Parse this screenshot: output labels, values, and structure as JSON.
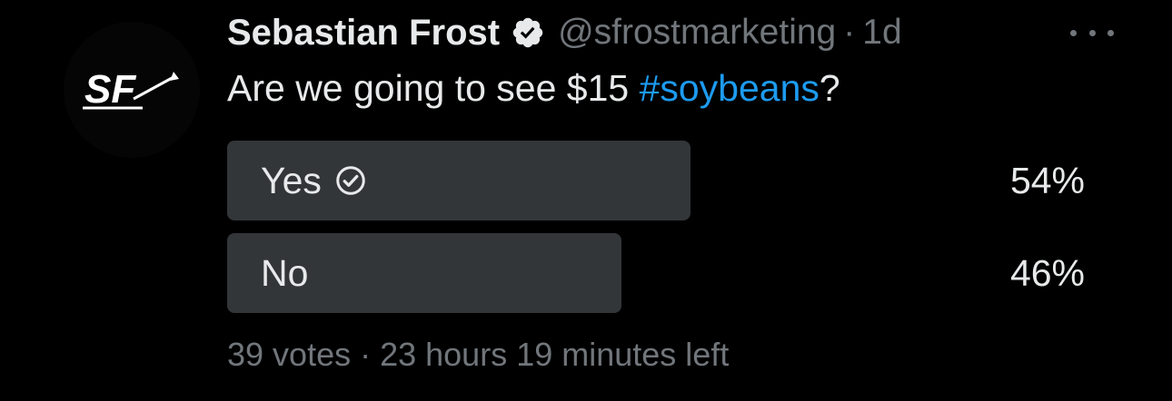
{
  "tweet": {
    "author_name": "Sebastian Frost",
    "handle": "@sfrostmarketing",
    "separator": "·",
    "age": "1d",
    "text_before": "Are we going to see $15 ",
    "hashtag": "#soybeans",
    "text_after": "?",
    "avatar_icon": "sf-logo-icon",
    "verified_icon": "verified-badge-icon",
    "more_icon": "more-options-icon",
    "colors": {
      "background": "#000000",
      "primary_text": "#e7e9ea",
      "secondary_text": "#71767b",
      "hashtag": "#1d9bf0",
      "poll_bar": "#333639"
    }
  },
  "poll": {
    "options": [
      {
        "label": "Yes",
        "percent_text": "54%",
        "percent": 54,
        "winner": true
      },
      {
        "label": "No",
        "percent_text": "46%",
        "percent": 46,
        "winner": false
      }
    ],
    "votes": "39 votes",
    "separator": "·",
    "time_left": "23 hours 19 minutes left",
    "winner_icon": "check-circle-icon"
  }
}
